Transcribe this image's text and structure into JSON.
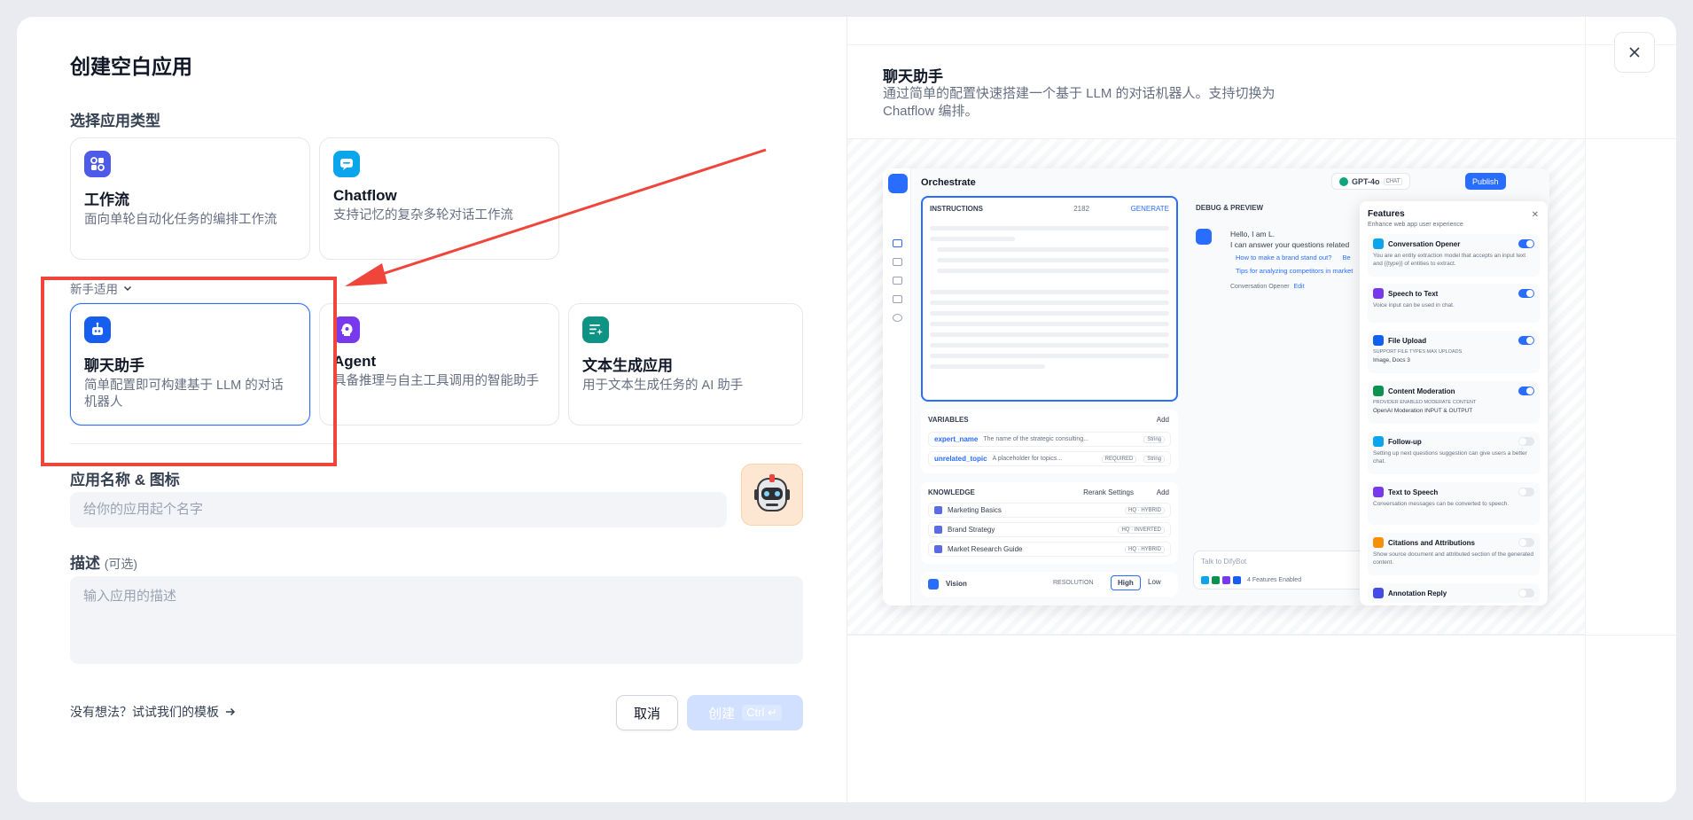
{
  "dialog": {
    "title": "创建空白应用",
    "app_type_label": "选择应用类型",
    "app_types": [
      {
        "key": "workflow",
        "title": "工作流",
        "desc": "面向单轮自动化任务的编排工作流",
        "icon": "workflow-icon",
        "color": "#4e5ae8"
      },
      {
        "key": "chatflow",
        "title": "Chatflow",
        "desc": "支持记忆的复杂多轮对话工作流",
        "icon": "chatflow-icon",
        "color": "#0ba5ec"
      }
    ],
    "beginner_label": "新手适用",
    "beginner_types": [
      {
        "key": "chatbot",
        "title": "聊天助手",
        "desc": "简单配置即可构建基于 LLM 的对话机器人",
        "icon": "robot-icon",
        "color": "#155eef",
        "selected": true
      },
      {
        "key": "agent",
        "title": "Agent",
        "desc": "具备推理与自主工具调用的智能助手",
        "icon": "agent-icon",
        "color": "#7839ee"
      },
      {
        "key": "completion",
        "title": "文本生成应用",
        "desc": "用于文本生成任务的 AI 助手",
        "icon": "text-generation-icon",
        "color": "#0e9384"
      }
    ],
    "name_label": "应用名称 & 图标",
    "name_placeholder": "给你的应用起个名字",
    "desc_label": "描述",
    "desc_optional": "(可选)",
    "desc_placeholder": "输入应用的描述",
    "template_link": "没有想法？试试我们的模板",
    "cancel": "取消",
    "create": "创建",
    "create_shortcut": "Ctrl ↵"
  },
  "preview": {
    "title": "聊天助手",
    "desc": "通过简单的配置快速搭建一个基于 LLM 的对话机器人。支持切换为 Chatflow 编排。",
    "shot": {
      "orchestrate": "Orchestrate",
      "model": "GPT-4o",
      "model_tag": "CHAT",
      "publish": "Publish",
      "instructions": "INSTRUCTIONS",
      "token_count": "2182",
      "generate": "GENERATE",
      "variables": "VARIABLES",
      "add": "Add",
      "vars": [
        {
          "name": "expert_name",
          "desc": "The name of the strategic consulting...",
          "type": "String"
        },
        {
          "name": "unrelated_topic",
          "desc": "A placeholder for topics...",
          "type": "String",
          "tag": "REQUIRED"
        }
      ],
      "knowledge": "KNOWLEDGE",
      "rerank": "Rerank Settings",
      "kb": [
        {
          "name": "Marketing Basics",
          "tag": "HQ · HYBRID"
        },
        {
          "name": "Brand Strategy",
          "tag": "HQ · INVERTED"
        },
        {
          "name": "Market Research Guide",
          "tag": "HQ · HYBRID"
        }
      ],
      "vision": "Vision",
      "resolution": "RESOLUTION",
      "high": "High",
      "low": "Low",
      "debug": "DEBUG & PREVIEW",
      "greeting1": "Hello, I am L.",
      "greeting2": "I can answer your questions related",
      "suggest1": "How to make a brand stand out?",
      "suggest1b": "Be",
      "suggest2": "Tips for analyzing competitors in market",
      "opener_note": "Conversation Opener",
      "opener_edit": "Edit",
      "talk_placeholder": "Talk to DifyBot",
      "features_enabled": "4 Features Enabled",
      "features_title": "Features",
      "features_sub": "Enhance web app user experience",
      "features": [
        {
          "name": "Conversation Opener",
          "desc": "You are an entity extraction model that accepts an input text and {{type}} of entities to extract.",
          "on": true,
          "color": "#0ba5ec"
        },
        {
          "name": "Speech to Text",
          "desc": "Voice input can be used in chat.",
          "on": true,
          "color": "#7839ee"
        },
        {
          "name": "File Upload",
          "desc": "SUPPORT FILE TYPES   MAX UPLOADS",
          "desc2": "Image, Docs   3",
          "on": true,
          "color": "#155eef"
        },
        {
          "name": "Content Moderation",
          "desc": "PROVIDER   ENABLED MODERATE CONTENT",
          "desc2": "OpenAI Moderation   INPUT & OUTPUT",
          "on": true,
          "color": "#099250"
        },
        {
          "name": "Follow-up",
          "desc": "Setting up next questions suggestion can give users a better chat.",
          "on": false,
          "color": "#0ba5ec"
        },
        {
          "name": "Text to Speech",
          "desc": "Conversation messages can be converted to speech.",
          "on": false,
          "color": "#7839ee"
        },
        {
          "name": "Citations and Attributions",
          "desc": "Show source document and attributed section of the generated content.",
          "on": false,
          "color": "#f79009"
        },
        {
          "name": "Annotation Reply",
          "desc": "",
          "on": false,
          "color": "#444ce7"
        }
      ]
    }
  }
}
